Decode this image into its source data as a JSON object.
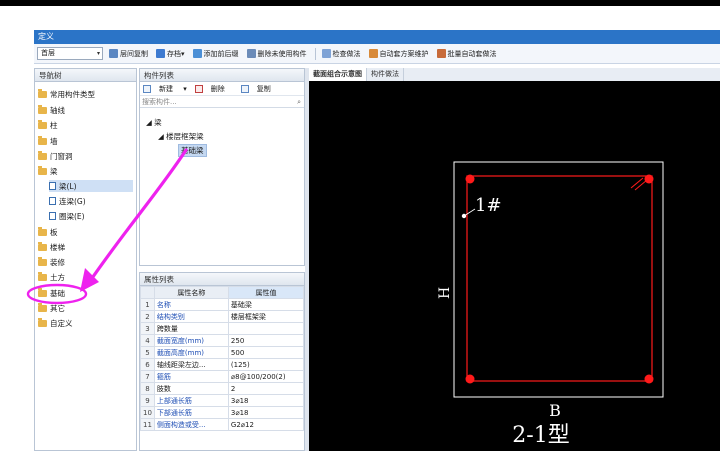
{
  "window": {
    "title": "定义"
  },
  "toolbar": {
    "floor_value": "首层",
    "buttons": [
      {
        "label": "层间复制",
        "icon": "copy-layers-icon"
      },
      {
        "label": "存档",
        "icon": "archive-icon"
      },
      {
        "label": "添加前后缀",
        "icon": "add-prefix-icon"
      },
      {
        "label": "删除未使用构件",
        "icon": "delete-unused-icon"
      },
      {
        "label": "检查做法",
        "icon": "check-method-icon"
      },
      {
        "label": "自动套方案维护",
        "icon": "auto-scheme-icon"
      },
      {
        "label": "批量自动套做法",
        "icon": "batch-auto-icon"
      }
    ]
  },
  "nav": {
    "title": "导航树",
    "items": [
      "常用构件类型",
      "轴线",
      "柱",
      "墙",
      "门窗洞",
      "梁",
      "板",
      "楼梯",
      "装修",
      "土方",
      "基础",
      "其它",
      "自定义"
    ],
    "beam_children": [
      "梁(L)",
      "连梁(G)",
      "圈梁(E)"
    ]
  },
  "component_list": {
    "title": "构件列表",
    "new_label": "新建",
    "delete_label": "删除",
    "copy_label": "复制",
    "search_placeholder": "搜索构件...",
    "tree_root": "梁",
    "tree_group": "楼层框架梁",
    "tree_leaf": "基础梁"
  },
  "property_list": {
    "title": "属性列表",
    "col_name": "属性名称",
    "col_value": "属性值",
    "rows": [
      {
        "n": "1",
        "name": "名称",
        "value": "基础梁"
      },
      {
        "n": "2",
        "name": "结构类别",
        "value": "楼层框架梁"
      },
      {
        "n": "3",
        "name": "跨数量",
        "value": ""
      },
      {
        "n": "4",
        "name": "截面宽度(mm)",
        "value": "250"
      },
      {
        "n": "5",
        "name": "截面高度(mm)",
        "value": "500"
      },
      {
        "n": "6",
        "name": "轴线距梁左边...",
        "value": "(125)"
      },
      {
        "n": "7",
        "name": "箍筋",
        "value": "⌀8@100/200(2)"
      },
      {
        "n": "8",
        "name": "肢数",
        "value": "2"
      },
      {
        "n": "9",
        "name": "上部通长筋",
        "value": "3⌀18"
      },
      {
        "n": "10",
        "name": "下部通长筋",
        "value": "3⌀18"
      },
      {
        "n": "11",
        "name": "侧面构造或受...",
        "value": "G2⌀12"
      }
    ]
  },
  "viewer": {
    "tab_active": "截面组合示意图",
    "tab_other": "构件做法",
    "rebar_label": "1#",
    "dim_h": "H",
    "dim_b": "B",
    "type_label": "2-1型"
  },
  "colors": {
    "accent": "#2b74c7",
    "annotation": "#ee22ee",
    "rebar": "#ff1a1a"
  }
}
